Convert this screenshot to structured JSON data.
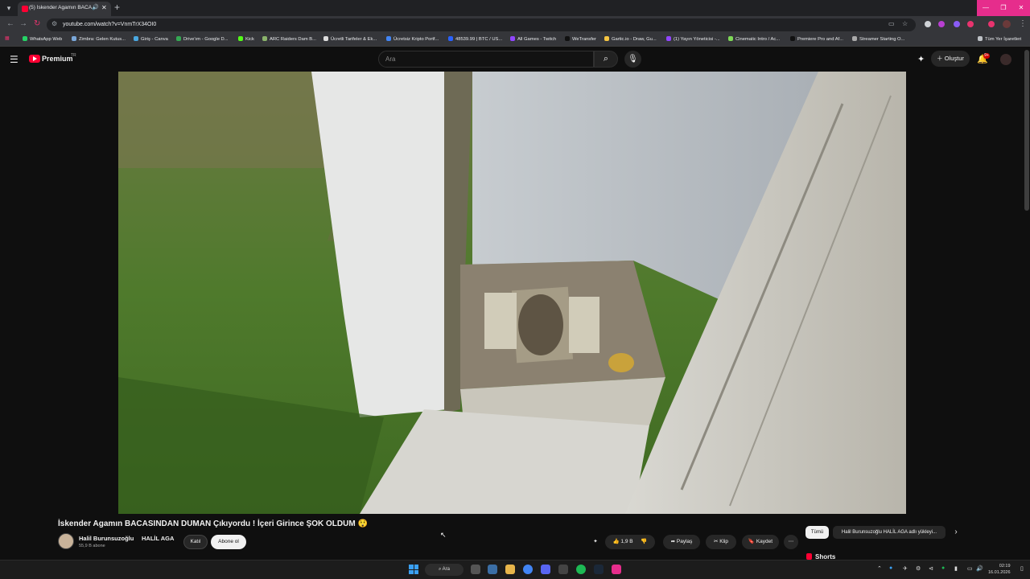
{
  "browser": {
    "tab_title": "(5) İskender Agamın BACA...",
    "url": "youtube.com/watch?v=VnmTrX34OI0",
    "bookmarks": [
      "WhatsApp Web",
      "Zimbra: Gelen Kutus...",
      "Giriş - Canva",
      "Drive'ım - Google D...",
      "Kick",
      "ARC Raiders Dam B...",
      "Ücretli Tarifeler & Ek...",
      "Ücretsiz Kripto Portf...",
      "48539.99 | BTC / US...",
      "All Games - Twitch",
      "WeTransfer",
      "Gartic.io - Draw, Gu...",
      "(1) Yayın Yöneticisi -...",
      "Cinematic Intro / Ac...",
      "Premiere Pro and Af...",
      "Streamer Starting O..."
    ],
    "all_bookmarks": "Tüm Yer İşaretleri"
  },
  "youtube": {
    "logo_text": "Premium",
    "country_code": "TR",
    "search_placeholder": "Ara",
    "create_label": "Oluştur",
    "notification_count": "9+"
  },
  "video": {
    "title": "İskender Agamın BACASINDAN DUMAN Çıkıyordu ! İçeri Girince ŞOK OLDUM 😲",
    "channel_name": "Halil Burunsuzoğlu",
    "channel_tag": "HALİL AGA",
    "subscribers": "55,9 B abone",
    "join_label": "Katıl",
    "subscribe_label": "Abone ol",
    "likes": "1,9 B",
    "share_label": "Paylaş",
    "clip_label": "Klip",
    "save_label": "Kaydet"
  },
  "sidebar": {
    "chips": [
      "Tümü",
      "Halil Burunsuzoğlu HALİL AGA adlı yükleyi..."
    ],
    "shorts_label": "Shorts"
  },
  "taskbar": {
    "search_label": "Ara",
    "time": "02:19",
    "date": "16.01.2026"
  },
  "colors": {
    "youtube_red": "#ff0033",
    "window_controls": "#e62d8c",
    "background": "#0f0f0f"
  }
}
